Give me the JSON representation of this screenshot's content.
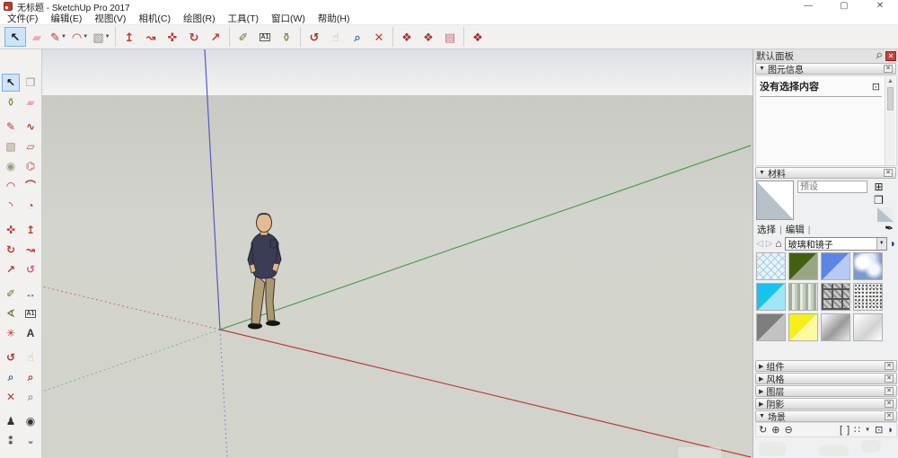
{
  "window": {
    "title": "无标题 - SketchUp Pro 2017",
    "controls": [
      {
        "name": "minimize-button",
        "glyph": "—"
      },
      {
        "name": "maximize-button",
        "glyph": "▢"
      },
      {
        "name": "close-button",
        "glyph": "✕"
      }
    ]
  },
  "menu": {
    "items": [
      "文件(F)",
      "编辑(E)",
      "视图(V)",
      "相机(C)",
      "绘图(R)",
      "工具(T)",
      "窗口(W)",
      "帮助(H)"
    ]
  },
  "top_toolbar": {
    "groups": [
      {
        "items": [
          {
            "name": "select-tool",
            "glyph": "↖",
            "color": "#111111",
            "active": true,
            "bold": true
          },
          {
            "name": "eraser-tool",
            "glyph": "▰",
            "color": "#eba8bc"
          },
          {
            "name": "line-tool",
            "glyph": "✎",
            "color": "#b03a2e",
            "dropdown": true
          },
          {
            "name": "arc-tool",
            "glyph": "◠",
            "color": "#c0392b",
            "dropdown": true
          },
          {
            "name": "rectangle-tool",
            "glyph": "▧",
            "color": "#8a8a8a",
            "dropdown": true
          }
        ]
      },
      {
        "items": [
          {
            "name": "pushpull-tool",
            "glyph": "↥",
            "color": "#c0392b",
            "bold": true
          },
          {
            "name": "followme-tool",
            "glyph": "↝",
            "color": "#c0392b",
            "bold": true
          },
          {
            "name": "move-tool",
            "glyph": "✜",
            "color": "#c0392b"
          },
          {
            "name": "rotate-tool",
            "glyph": "↻",
            "color": "#c0392b",
            "bold": true
          },
          {
            "name": "scale-tool",
            "glyph": "↗",
            "color": "#c0392b",
            "bold": true
          }
        ]
      },
      {
        "items": [
          {
            "name": "tape-measure-tool",
            "glyph": "✐",
            "color": "#6b7a2a"
          },
          {
            "name": "text-tool",
            "text": "A1"
          },
          {
            "name": "paint-bucket-tool",
            "glyph": "⚱",
            "color": "#8a7a28"
          }
        ]
      },
      {
        "items": [
          {
            "name": "orbit-tool",
            "glyph": "↺",
            "color": "#b03030",
            "bold": true
          },
          {
            "name": "pan-tool",
            "glyph": "☝",
            "color": "#c8a878"
          },
          {
            "name": "zoom-tool",
            "glyph": "⌕",
            "color": "#3a6ea5",
            "bold": true
          },
          {
            "name": "zoom-extents-tool",
            "glyph": "✕",
            "color": "#c0392b",
            "bold": true
          }
        ]
      },
      {
        "items": [
          {
            "name": "get-models-button",
            "glyph": "❖",
            "color": "#b03030"
          },
          {
            "name": "share-model-button",
            "glyph": "❖",
            "color": "#a83838"
          },
          {
            "name": "share-component-button",
            "glyph": "▤",
            "color": "#c86a7a"
          }
        ]
      },
      {
        "items": [
          {
            "name": "extension-warehouse-button",
            "glyph": "❖",
            "color": "#a02828"
          }
        ]
      }
    ]
  },
  "left_toolbar": {
    "groups": [
      {
        "rows": [
          [
            {
              "name": "select-tool",
              "glyph": "↖",
              "color": "#111111",
              "active": true,
              "bold": true
            },
            {
              "name": "make-component-tool",
              "glyph": "❒",
              "color": "#9a9a9a"
            }
          ],
          [
            {
              "name": "paint-bucket-tool",
              "glyph": "⚱",
              "color": "#8a7a28"
            },
            {
              "name": "eraser-tool",
              "glyph": "▰",
              "color": "#eba8bc"
            }
          ]
        ]
      },
      {
        "rows": [
          [
            {
              "name": "line-tool",
              "glyph": "✎",
              "color": "#b03a2e"
            },
            {
              "name": "freehand-tool",
              "glyph": "∿",
              "color": "#b03a2e",
              "bold": true
            }
          ],
          [
            {
              "name": "rectangle-tool",
              "glyph": "▧",
              "color": "#9a8a7a"
            },
            {
              "name": "rotated-rectangle-tool",
              "glyph": "▱",
              "color": "#b05a4a"
            }
          ],
          [
            {
              "name": "circle-tool",
              "glyph": "◉",
              "color": "#a09a80"
            },
            {
              "name": "polygon-tool",
              "glyph": "⌬",
              "color": "#b05a4a"
            }
          ],
          [
            {
              "name": "arc-tool",
              "glyph": "◠",
              "color": "#b03a2e",
              "bold": true
            },
            {
              "name": "two-point-arc-tool",
              "glyph": "⌒",
              "color": "#b03a2e",
              "bold": true
            }
          ],
          [
            {
              "name": "three-point-arc-tool",
              "glyph": "◝",
              "color": "#b03a2e"
            },
            {
              "name": "pie-tool",
              "glyph": "◔",
              "color": "#b03a2e"
            }
          ]
        ]
      },
      {
        "rows": [
          [
            {
              "name": "move-tool",
              "glyph": "✜",
              "color": "#c0392b"
            },
            {
              "name": "pushpull-tool",
              "glyph": "↥",
              "color": "#c0392b",
              "bold": true
            }
          ],
          [
            {
              "name": "rotate-tool",
              "glyph": "↻",
              "color": "#c0392b",
              "bold": true
            },
            {
              "name": "followme-tool",
              "glyph": "↝",
              "color": "#c0392b",
              "bold": true
            }
          ],
          [
            {
              "name": "scale-tool",
              "glyph": "↗",
              "color": "#c0392b",
              "bold": true
            },
            {
              "name": "offset-tool",
              "glyph": "↺",
              "color": "#d06080",
              "bold": true
            }
          ]
        ]
      },
      {
        "rows": [
          [
            {
              "name": "tape-measure-tool",
              "glyph": "✐",
              "color": "#6b7a2a"
            },
            {
              "name": "dimension-tool",
              "glyph": "↔",
              "color": "#555555",
              "bold": true
            }
          ],
          [
            {
              "name": "protractor-tool",
              "glyph": "∢",
              "color": "#6b7a2a",
              "bold": true
            },
            {
              "name": "text-tool",
              "text": "A1"
            }
          ],
          [
            {
              "name": "axes-tool",
              "glyph": "✳",
              "color": "#c0392b"
            },
            {
              "name": "three-d-text-tool",
              "glyph": "A",
              "color": "#333333",
              "bold": true
            }
          ]
        ]
      },
      {
        "rows": [
          [
            {
              "name": "orbit-tool",
              "glyph": "↺",
              "color": "#b03030",
              "bold": true
            },
            {
              "name": "pan-tool",
              "glyph": "☝",
              "color": "#c8a878"
            }
          ],
          [
            {
              "name": "zoom-tool",
              "glyph": "⌕",
              "color": "#3a6ea5",
              "bold": true
            },
            {
              "name": "zoom-window-tool",
              "glyph": "⌕",
              "color": "#c0392b",
              "bold": true
            }
          ],
          [
            {
              "name": "zoom-extents-tool",
              "glyph": "✕",
              "color": "#c0392b",
              "bold": true
            },
            {
              "name": "zoom-previous-tool",
              "glyph": "⌕",
              "color": "#999999",
              "bold": true
            }
          ]
        ]
      },
      {
        "rows": [
          [
            {
              "name": "position-camera-tool",
              "glyph": "♟",
              "color": "#333333"
            },
            {
              "name": "look-around-tool",
              "glyph": "◉",
              "color": "#333333"
            }
          ],
          [
            {
              "name": "walk-tool",
              "glyph": "⁑",
              "color": "#333333",
              "bold": true
            },
            {
              "name": "section-plane-tool",
              "glyph": "◒",
              "color": "#888888"
            }
          ]
        ]
      }
    ]
  },
  "viewport": {
    "sky_top_color": "#dcdfe6",
    "ground_color": "#d2d3cb",
    "axis_colors": {
      "red": "#b83c3c",
      "green": "#4f9e52",
      "blue": "#5757c8"
    }
  },
  "panel": {
    "title": "默认面板",
    "entity_info": {
      "title": "图元信息",
      "empty_text": "没有选择内容"
    },
    "materials": {
      "title": "材料",
      "name_placeholder": "预设",
      "tabs": [
        "选择",
        "编辑"
      ],
      "collection": "玻璃和镜子",
      "swatches": [
        {
          "name": "material-glass-lattice",
          "css": "repeating-linear-gradient(45deg,#aacde4 0 1px,transparent 1px 6px),repeating-linear-gradient(-45deg,#aacde4 0 1px,transparent 1px 6px),#e8f3fa"
        },
        {
          "name": "material-glass-dark-green",
          "css": "linear-gradient(135deg,#44600f 49.5%,#98a686 50.5%)"
        },
        {
          "name": "material-glass-blue",
          "css": "linear-gradient(135deg,#5b86e8 49.5%,#b9c9f6 50.5%)"
        },
        {
          "name": "material-glass-sky-reflection",
          "css": "radial-gradient(circle at 30% 35%,#ffffff 0 22%,transparent 42%),radial-gradient(circle at 72% 62%,#f4f7fb 0 18%,transparent 40%),radial-gradient(circle at 55% 20%,#dfe8f4 0 20%,transparent 45%),#7e99cc"
        },
        {
          "name": "material-glass-cyan",
          "css": "linear-gradient(135deg,#17c2ec 49.5%,#9fe6f7 50.5%)"
        },
        {
          "name": "material-glass-fluted",
          "css": "repeating-linear-gradient(90deg,#9fae9d 0 3px,#e6eadf 3px 6px,#c3ccbd 6px 9px)"
        },
        {
          "name": "material-glass-blocks",
          "css": "repeating-linear-gradient(0deg,#565656 0 2px,transparent 2px 11px),repeating-linear-gradient(90deg,#565656 0 2px,transparent 2px 11px),repeating-linear-gradient(45deg,#8e8e8e 0 2px,#c9c9c9 2px 5px)"
        },
        {
          "name": "material-glass-obscure",
          "css": "radial-gradient(#5a5a5a 1px,transparent 1.3px) 0 0/4px 4px,radial-gradient(#9a9a9a 1px,transparent 1.3px) 2px 2px/5px 5px,#f4f4f2"
        },
        {
          "name": "material-glass-grey",
          "css": "linear-gradient(135deg,#7d7d7d 49.5%,#c2c2c2 50.5%)"
        },
        {
          "name": "material-glass-yellow",
          "css": "linear-gradient(135deg,#f6ef1a 49.5%,#fbf9a2 50.5%)"
        },
        {
          "name": "material-mirror-silver",
          "css": "linear-gradient(135deg,#fefefe 0%,#9a9a9a 55%,#e8e8e8 100%)"
        },
        {
          "name": "material-mirror-white",
          "css": "linear-gradient(135deg,#ffffff 0%,#d2d2d2 60%,#ffffff 100%)"
        }
      ]
    },
    "sections": [
      {
        "label": "组件",
        "expanded": false
      },
      {
        "label": "风格",
        "expanded": false
      },
      {
        "label": "图层",
        "expanded": false
      },
      {
        "label": "阴影",
        "expanded": false
      },
      {
        "label": "场景",
        "expanded": true
      }
    ],
    "scenes_toolbar": [
      {
        "name": "update-scene-button",
        "glyph": "↻"
      },
      {
        "name": "add-scene-button",
        "glyph": "⊕"
      },
      {
        "name": "remove-scene-button",
        "glyph": "⊖"
      }
    ],
    "scenes_toolbar_right": [
      {
        "name": "scene-bracket-left-icon",
        "glyph": "["
      },
      {
        "name": "scene-bracket-right-icon",
        "glyph": "]"
      },
      {
        "name": "view-options-button",
        "glyph": "∷",
        "dropdown": true
      },
      {
        "name": "show-details-button",
        "glyph": "⊡"
      },
      {
        "name": "move-scene-button",
        "glyph": "◗",
        "color": "#1d3a7c"
      }
    ]
  }
}
